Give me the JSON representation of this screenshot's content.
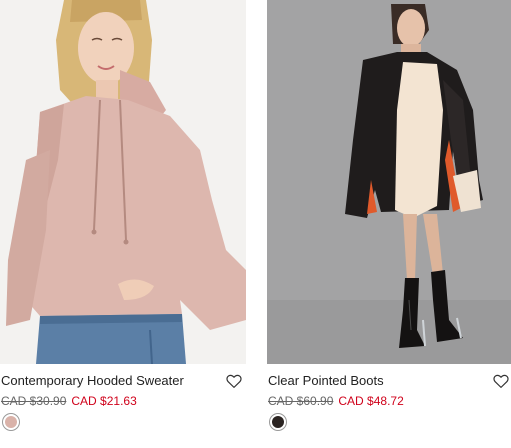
{
  "products": [
    {
      "name": "Contemporary Hooded Sweater",
      "price_original": "CAD $30.90",
      "price_sale": "CAD $21.63",
      "swatch_color": "#d9b2a9"
    },
    {
      "name": "Clear Pointed Boots",
      "price_original": "CAD $60.90",
      "price_sale": "CAD $48.72",
      "swatch_color": "#2b2422"
    }
  ],
  "colors": {
    "sale": "#d0021b",
    "text": "#222222",
    "strike": "#666666"
  }
}
